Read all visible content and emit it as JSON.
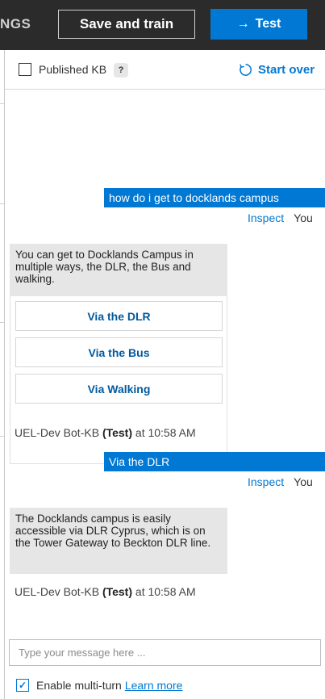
{
  "topbar": {
    "partial_tab": "NGS",
    "save_label": "Save and train",
    "test_label": "Test",
    "test_icon": "arrow-right-icon",
    "accent": "#0078d4"
  },
  "header": {
    "published_label": "Published KB",
    "help_glyph": "?",
    "start_over_label": "Start over",
    "start_over_icon": "refresh-icon"
  },
  "messages": [
    {
      "from": "user",
      "text": "how do i get to docklands campus",
      "inspect": "Inspect",
      "sender": "You"
    },
    {
      "from": "bot",
      "text": "You can get to Docklands Campus in multiple ways, the DLR, the Bus and walking.",
      "options": [
        "Via the DLR",
        "Via the Bus",
        "Via Walking"
      ],
      "meta_name": "UEL-Dev Bot-KB",
      "meta_tag": "(Test)",
      "meta_time": "at 10:58 AM"
    },
    {
      "from": "user",
      "text": "Via the DLR",
      "inspect": "Inspect",
      "sender": "You"
    },
    {
      "from": "bot",
      "text": "The Docklands campus is easily accessible via DLR Cyprus, which is on the Tower Gateway to Beckton DLR line.",
      "meta_name": "UEL-Dev Bot-KB",
      "meta_tag": "(Test)",
      "meta_time": "at 10:58 AM"
    }
  ],
  "input": {
    "placeholder": "Type your message here ..."
  },
  "footer": {
    "multiturn_label": "Enable multi-turn",
    "learn_more": "Learn more",
    "multiturn_checked": true
  }
}
